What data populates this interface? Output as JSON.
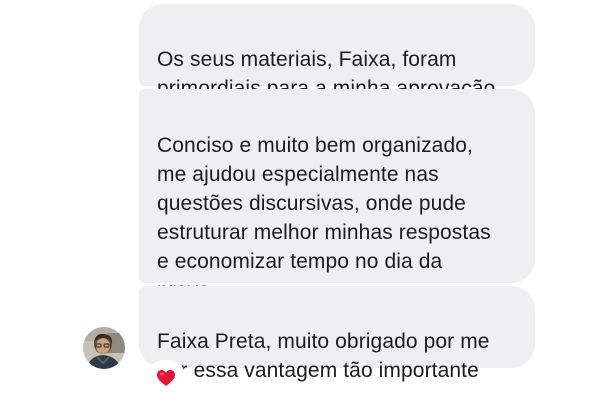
{
  "chat": {
    "messages": [
      {
        "text": "Os seus materiais, Faixa, foram\nprimordiais para a minha aprovação"
      },
      {
        "text": "Conciso e muito bem organizado,\nme ajudou especialmente nas\nquestões discursivas, onde pude\nestruturar melhor minhas respostas\ne economizar tempo no dia da\nprova"
      },
      {
        "text": "Faixa Preta, muito obrigado por me\ndar essa vantagem tão importante"
      }
    ],
    "reaction": {
      "icon": "heart-icon",
      "color": "#e0163a"
    },
    "bubble_color": "#efeff1"
  }
}
